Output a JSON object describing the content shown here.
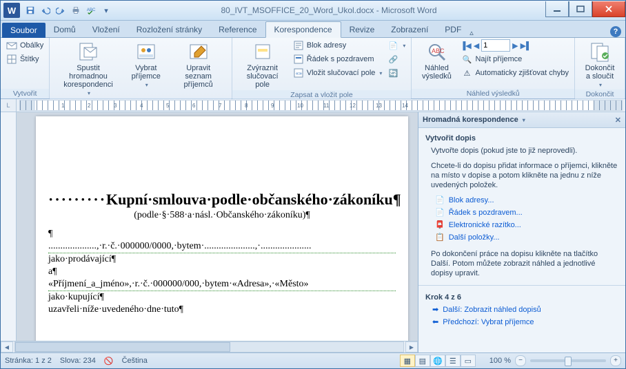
{
  "title": "80_IVT_MSOFFICE_20_Word_Ukol.docx - Microsoft Word",
  "file_tab": "Soubor",
  "tabs": [
    "Domů",
    "Vložení",
    "Rozložení stránky",
    "Reference",
    "Korespondence",
    "Revize",
    "Zobrazení",
    "PDF"
  ],
  "active_tab": 4,
  "ribbon": {
    "g1": {
      "label": "Vytvořit",
      "envelopes": "Obálky",
      "labels": "Štítky"
    },
    "g2": {
      "label": "Spustit hromadnou korespondenci",
      "start": "Spustit hromadnou\nkorespondenci",
      "select": "Vybrat\npříjemce",
      "edit": "Upravit seznam\npříjemců"
    },
    "g3": {
      "label": "Zapsat a vložit pole",
      "highlight": "Zvýraznit\nslučovací pole",
      "block": "Blok adresy",
      "greet": "Řádek s pozdravem",
      "insert": "Vložit slučovací pole"
    },
    "g4": {
      "label": "Náhled výsledků",
      "preview": "Náhled\nvýsledků",
      "record": "1",
      "find": "Najít příjemce",
      "check": "Automaticky zjišťovat chyby"
    },
    "g5": {
      "label": "Dokončit",
      "finish": "Dokončit\na sloučit"
    }
  },
  "ruler_numbers": [
    "",
    "1",
    "2",
    "3",
    "4",
    "5",
    "6",
    "7",
    "8",
    "9",
    "10",
    "11",
    "12",
    "13",
    "14"
  ],
  "document": {
    "heading": "Kupní·smlouva·podle·občanského·zákoníku¶",
    "heading_prefix": "·········",
    "sub": "(podle·§·588·a·násl.·Občanského·zákoníku)¶",
    "l1": "¶",
    "l2": "....................,·r.·č.·000000/0000,·bytem·.....................,·.....................",
    "l3": "jako·prodávající¶",
    "l4": "a¶",
    "l5": "«Příjmení_a_jméno»,·r.·č.·000000/000,·bytem·«Adresa»,·«Město»",
    "l6": "jako·kupující¶",
    "l7": "uzavřeli·níže·uvedeného·dne·tuto¶"
  },
  "pane": {
    "title": "Hromadná korespondence",
    "h1": "Vytvořit dopis",
    "p1": "Vytvořte dopis (pokud jste to již neprovedli).",
    "p2": "Chcete-li do dopisu přidat informace o příjemci, klikněte na místo v dopise a potom klikněte na jednu z níže uvedených položek.",
    "links": [
      "Blok adresy...",
      "Řádek s pozdravem...",
      "Elektronické razítko...",
      "Další položky..."
    ],
    "p3": "Po dokončení práce na dopisu klikněte na tlačítko Další. Potom můžete zobrazit náhled a jednotlivé dopisy upravit.",
    "step": "Krok 4 z 6",
    "next": "Další: Zobrazit náhled dopisů",
    "prev": "Předchozí: Vybrat příjemce"
  },
  "status": {
    "page": "Stránka: 1 z 2",
    "words": "Slova: 234",
    "lang": "Čeština",
    "zoom": "100 %"
  }
}
